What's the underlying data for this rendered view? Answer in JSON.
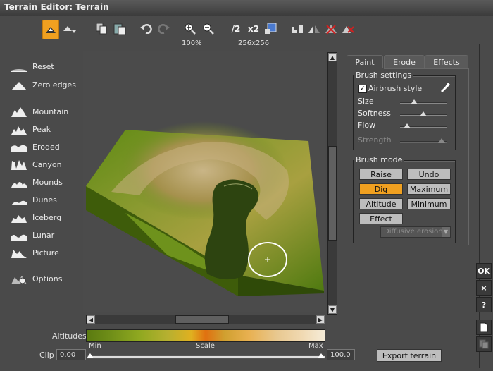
{
  "window": {
    "title": "Terrain Editor: Terrain"
  },
  "toolbar": {
    "zoom_value": "100%",
    "size_value": "256x256",
    "halve_label": "/2",
    "double_label": "x2"
  },
  "left_menu": [
    {
      "label": "Reset",
      "icon": "flat-icon"
    },
    {
      "label": "Zero edges",
      "icon": "pyramid-icon"
    },
    {
      "label": "Mountain",
      "icon": "mountain-icon"
    },
    {
      "label": "Peak",
      "icon": "peak-icon"
    },
    {
      "label": "Eroded",
      "icon": "eroded-icon"
    },
    {
      "label": "Canyon",
      "icon": "canyon-icon"
    },
    {
      "label": "Mounds",
      "icon": "mounds-icon"
    },
    {
      "label": "Dunes",
      "icon": "dunes-icon"
    },
    {
      "label": "Iceberg",
      "icon": "iceberg-icon"
    },
    {
      "label": "Lunar",
      "icon": "lunar-icon"
    },
    {
      "label": "Picture",
      "icon": "picture-icon"
    },
    {
      "label": "Options",
      "icon": "options-icon"
    }
  ],
  "tabs": {
    "paint": "Paint",
    "erode": "Erode",
    "effects": "Effects"
  },
  "brush_settings": {
    "title": "Brush settings",
    "airbrush_label": "Airbrush style",
    "airbrush_checked": true,
    "size_label": "Size",
    "size_value": 0.3,
    "softness_label": "Softness",
    "softness_value": 0.5,
    "flow_label": "Flow",
    "flow_value": 0.15,
    "strength_label": "Strength",
    "strength_value": 0.9
  },
  "brush_mode": {
    "title": "Brush mode",
    "raise": "Raise",
    "undo": "Undo",
    "dig": "Dig",
    "maximum": "Maximum",
    "altitude": "Altitude",
    "minimum": "Minimum",
    "effect": "Effect",
    "effect_select": "Diffusive erosion"
  },
  "side_buttons": {
    "ok": "OK",
    "close": "×",
    "help": "?"
  },
  "altitudes": {
    "label": "Altitudes",
    "min": "Min",
    "scale": "Scale",
    "max": "Max"
  },
  "clip": {
    "label": "Clip",
    "min_value": "0.00",
    "max_value": "100.0"
  },
  "export_label": "Export terrain",
  "colors": {
    "accent": "#f0a020",
    "panel": "#4a4a4a"
  }
}
